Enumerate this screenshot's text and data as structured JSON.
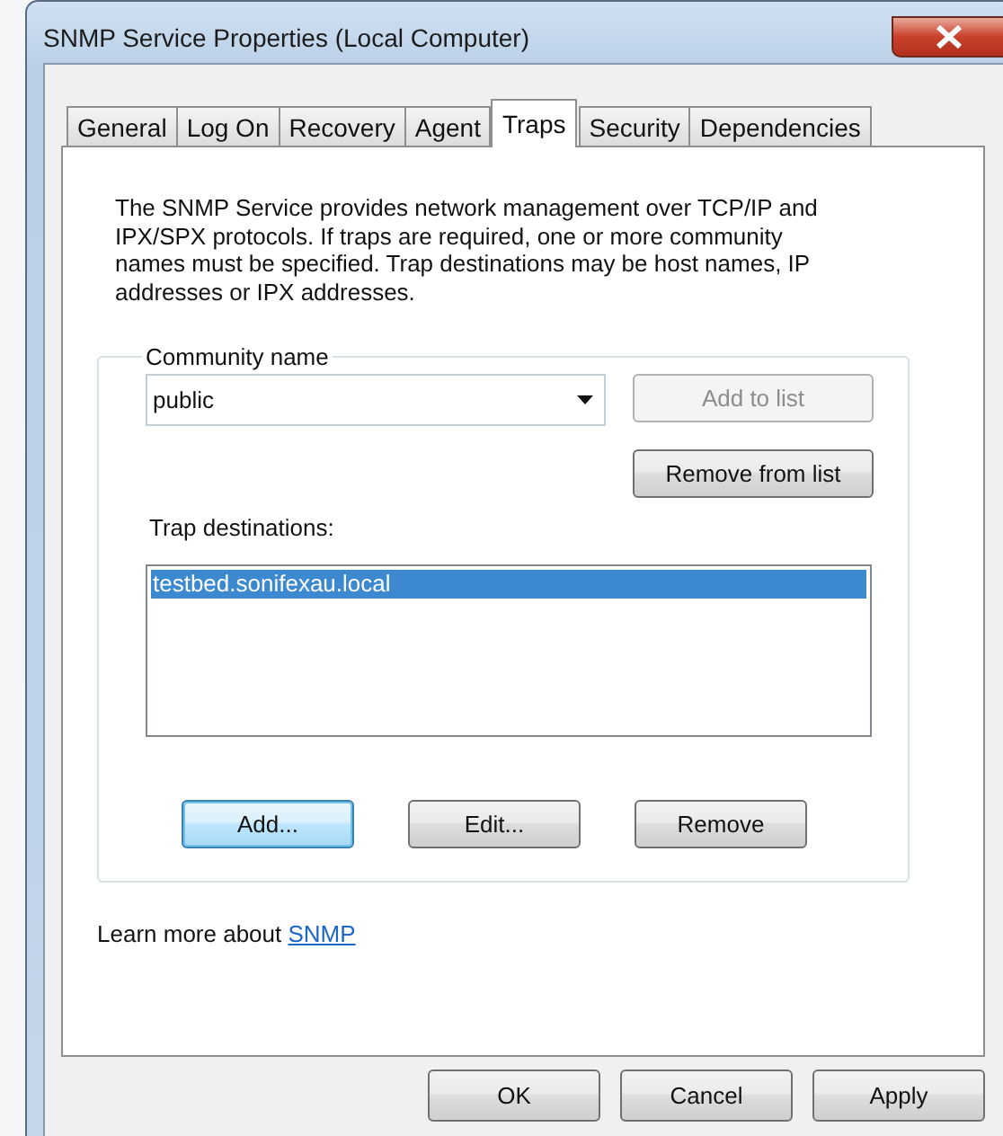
{
  "window": {
    "title": "SNMP Service Properties (Local Computer)"
  },
  "tabs": [
    {
      "label": "General",
      "selected": false
    },
    {
      "label": "Log On",
      "selected": false
    },
    {
      "label": "Recovery",
      "selected": false
    },
    {
      "label": "Agent",
      "selected": false
    },
    {
      "label": "Traps",
      "selected": true
    },
    {
      "label": "Security",
      "selected": false
    },
    {
      "label": "Dependencies",
      "selected": false
    }
  ],
  "description": "The SNMP Service provides network management over TCP/IP and IPX/SPX protocols. If traps are required, one or more community names must be specified. Trap destinations may be host names, IP addresses or IPX addresses.",
  "community_group": {
    "label": "Community name",
    "community_name": "public",
    "side_buttons": [
      {
        "label": "Add to list",
        "disabled": true
      },
      {
        "label": "Remove from list",
        "disabled": false
      }
    ],
    "trap_label": "Trap destinations:",
    "trap_destinations": [
      {
        "text": "testbed.sonifexau.local",
        "selected": true
      }
    ],
    "buttons": [
      {
        "label": "Add...",
        "focused": true
      },
      {
        "label": "Edit...",
        "focused": false
      },
      {
        "label": "Remove",
        "focused": false
      }
    ]
  },
  "learn_more": {
    "text": "Learn more about",
    "link": "SNMP"
  },
  "dialog_buttons": [
    {
      "label": "OK"
    },
    {
      "label": "Cancel"
    },
    {
      "label": "Apply"
    }
  ]
}
